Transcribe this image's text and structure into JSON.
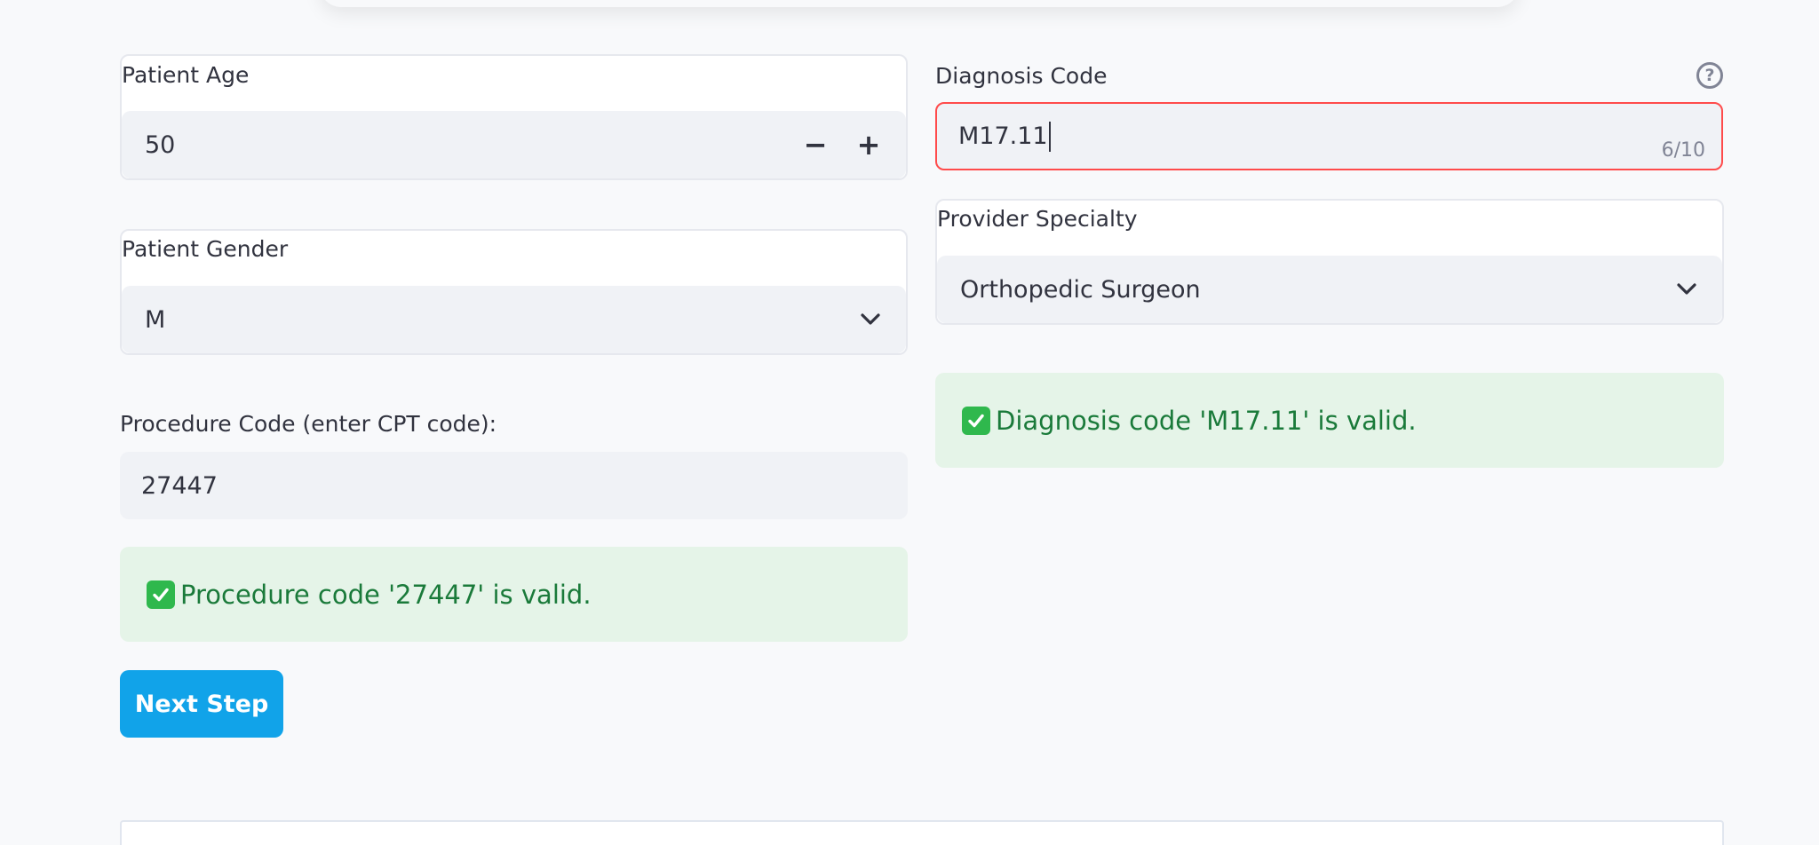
{
  "form": {
    "patient_age": {
      "label": "Patient Age",
      "value": "50",
      "decrement": "−",
      "increment": "+"
    },
    "patient_gender": {
      "label": "Patient Gender",
      "value": "M"
    },
    "procedure_code": {
      "label": "Procedure Code (enter CPT code):",
      "value": "27447"
    },
    "procedure_alert": {
      "text": "Procedure code '27447' is valid."
    },
    "diagnosis_code": {
      "label": "Diagnosis Code",
      "value": "M17.11",
      "counter": "6/10",
      "help": "?"
    },
    "provider_specialty": {
      "label": "Provider Specialty",
      "value": "Orthopedic Surgeon"
    },
    "diagnosis_alert": {
      "text": "Diagnosis code 'M17.11' is valid."
    },
    "next_button": {
      "label": "Next Step"
    }
  },
  "colors": {
    "accent": "#11a3e9",
    "success_bg": "#e5f4e8",
    "success_text": "#1a7a3a",
    "error_border": "#ff4b4b"
  }
}
